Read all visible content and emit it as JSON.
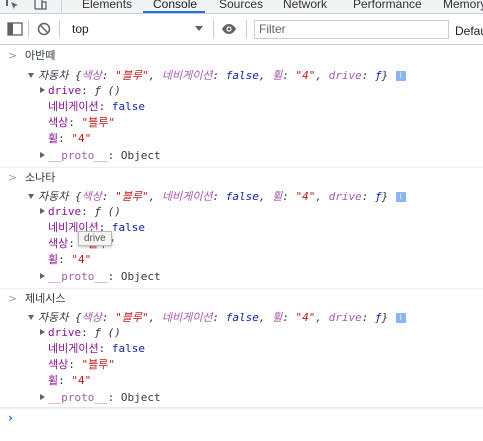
{
  "tabs": [
    "Elements",
    "Console",
    "Sources",
    "Network",
    "Performance",
    "Memory"
  ],
  "active_tab": "Console",
  "toolbar": {
    "context_value": "top",
    "filter_placeholder": "Filter",
    "levels_label": "Defau"
  },
  "icons": {
    "inspect": "inspect-icon",
    "device": "device-toggle-icon",
    "sidebar": "sidebar-toggle-icon",
    "clear": "clear-console-icon",
    "eye": "eye-icon",
    "expand": "triangle-down-icon",
    "collapse": "triangle-right-icon",
    "info": "info-icon"
  },
  "colors": {
    "tab_underline": "#1a73e8",
    "property_name": "#881391",
    "string": "#c41a16",
    "keyword": "#0d22aa",
    "prompt": "#1a73e8"
  },
  "logs": [
    {
      "label": "아반떼",
      "summary": {
        "prefix": "자동차",
        "open": " {",
        "k1": "색상",
        "v1": "\"블루\"",
        "k2": "네비게이션",
        "v2": "false",
        "k3": "휠",
        "v3": "\"4\"",
        "k4": "drive",
        "v4": "ƒ",
        "close": "}",
        "info": "i"
      },
      "props": {
        "drive_key": "drive",
        "drive_val": "ƒ ()",
        "nav_key": "네비게이션",
        "nav_val": "false",
        "color_key": "색상",
        "color_val": "\"블루\"",
        "wheel_key": "휠",
        "wheel_val": "\"4\"",
        "proto_key": "__proto__",
        "proto_val": "Object"
      }
    },
    {
      "label": "소나타",
      "summary": {
        "prefix": "자동차",
        "open": " {",
        "k1": "색상",
        "v1": "\"블루\"",
        "k2": "네비게이션",
        "v2": "false",
        "k3": "휠",
        "v3": "\"4\"",
        "k4": "drive",
        "v4": "ƒ",
        "close": "}",
        "info": "i"
      },
      "props": {
        "drive_key": "drive",
        "drive_val": "ƒ ()",
        "nav_key": "네비게이션",
        "nav_val": "false",
        "color_key": "색상",
        "color_val": "\"블루\"",
        "wheel_key": "휠",
        "wheel_val": "\"4\"",
        "proto_key": "__proto__",
        "proto_val": "Object"
      }
    },
    {
      "label": "제네시스",
      "summary": {
        "prefix": "자동차",
        "open": " {",
        "k1": "색상",
        "v1": "\"블루\"",
        "k2": "네비게이션",
        "v2": "false",
        "k3": "휠",
        "v3": "\"4\"",
        "k4": "drive",
        "v4": "ƒ",
        "close": "}",
        "info": "i"
      },
      "props": {
        "drive_key": "drive",
        "drive_val": "ƒ ()",
        "nav_key": "네비게이션",
        "nav_val": "false",
        "color_key": "색상",
        "color_val": "\"블루\"",
        "wheel_key": "휠",
        "wheel_val": "\"4\"",
        "proto_key": "__proto__",
        "proto_val": "Object"
      }
    }
  ],
  "tooltip": "drive",
  "prompt_symbol": "›",
  "line_prompt": ">"
}
